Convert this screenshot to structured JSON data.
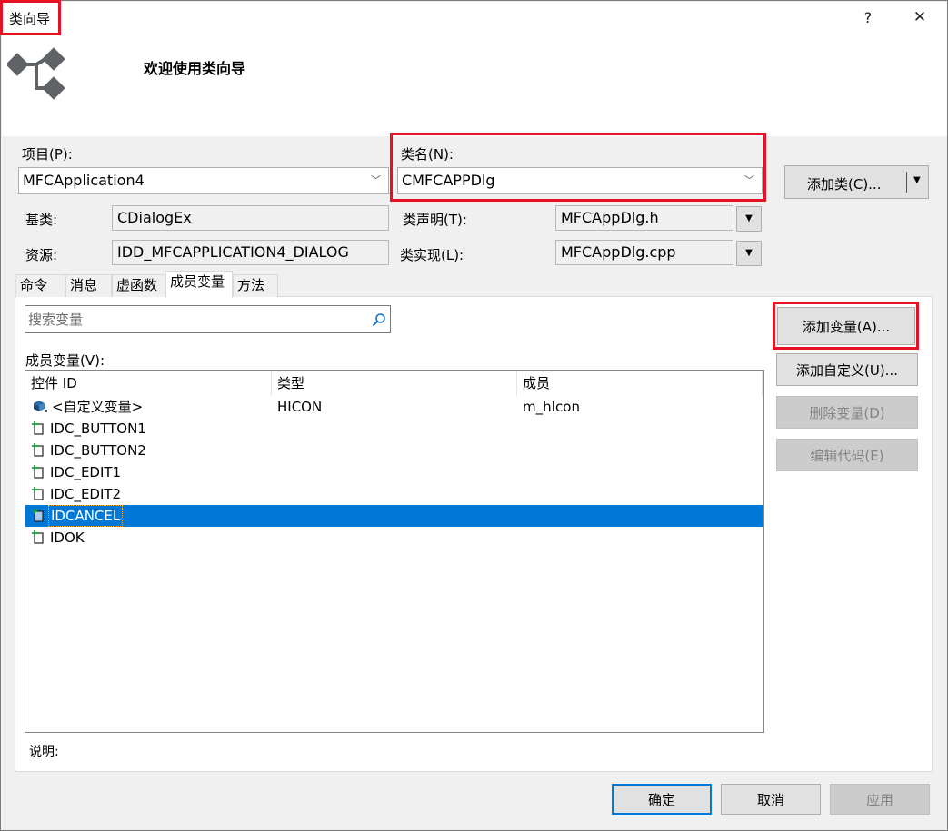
{
  "window": {
    "title": "类向导",
    "help_glyph": "?",
    "close_glyph": "✕"
  },
  "header": {
    "welcome": "欢迎使用类向导"
  },
  "project": {
    "label": "项目(P):",
    "value": "MFCApplication4"
  },
  "class_name": {
    "label": "类名(N):",
    "value": "CMFCAPPDlg"
  },
  "add_class_button": "添加类(C)...",
  "base_class": {
    "label": "基类:",
    "value": "CDialogEx"
  },
  "resource": {
    "label": "资源:",
    "value": "IDD_MFCAPPLICATION4_DIALOG"
  },
  "class_declaration": {
    "label": "类声明(T):",
    "value": "MFCAppDlg.h"
  },
  "class_implementation": {
    "label": "类实现(L):",
    "value": "MFCAppDlg.cpp"
  },
  "tabs": [
    {
      "label": "命令"
    },
    {
      "label": "消息"
    },
    {
      "label": "虚函数"
    },
    {
      "label": "成员变量"
    },
    {
      "label": "方法"
    }
  ],
  "active_tab": "成员变量",
  "search": {
    "placeholder": "搜索变量"
  },
  "member_list": {
    "label": "成员变量(V):",
    "columns": [
      "控件 ID",
      "类型",
      "成员"
    ],
    "rows": [
      {
        "id": "<自定义变量>",
        "type": "HICON",
        "member": "m_hIcon"
      },
      {
        "id": "IDC_BUTTON1",
        "type": "",
        "member": ""
      },
      {
        "id": "IDC_BUTTON2",
        "type": "",
        "member": ""
      },
      {
        "id": "IDC_EDIT1",
        "type": "",
        "member": ""
      },
      {
        "id": "IDC_EDIT2",
        "type": "",
        "member": ""
      },
      {
        "id": "IDCANCEL",
        "type": "",
        "member": ""
      },
      {
        "id": "IDOK",
        "type": "",
        "member": ""
      }
    ],
    "selected_row": "IDCANCEL"
  },
  "side_buttons": {
    "add_variable": "添加变量(A)...",
    "add_custom": "添加自定义(U)...",
    "delete_variable": "删除变量(D)",
    "edit_code": "编辑代码(E)"
  },
  "description_label": "说明:",
  "footer": {
    "ok": "确定",
    "cancel": "取消",
    "apply": "应用"
  },
  "colors": {
    "highlight_box": "#e81123",
    "selection": "#0078d7"
  }
}
